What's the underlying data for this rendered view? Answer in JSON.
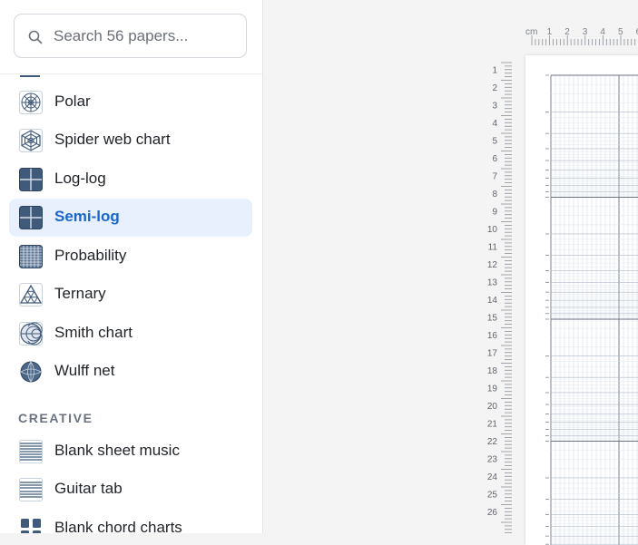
{
  "search": {
    "placeholder": "Search 56 papers..."
  },
  "items": [
    {
      "label": "Polar",
      "icon": "polar-grid-icon",
      "active": false
    },
    {
      "label": "Spider web chart",
      "icon": "spider-web-icon",
      "active": false
    },
    {
      "label": "Log-log",
      "icon": "log-log-grid-icon",
      "active": false
    },
    {
      "label": "Semi-log",
      "icon": "semi-log-grid-icon",
      "active": true
    },
    {
      "label": "Probability",
      "icon": "probability-grid-icon",
      "active": false
    },
    {
      "label": "Ternary",
      "icon": "ternary-triangle-icon",
      "active": false
    },
    {
      "label": "Smith chart",
      "icon": "smith-chart-icon",
      "active": false
    },
    {
      "label": "Wulff net",
      "icon": "wulff-net-icon",
      "active": false
    }
  ],
  "section_creative": "CREATIVE",
  "creative_items": [
    {
      "label": "Blank sheet music",
      "icon": "staff-lines-icon"
    },
    {
      "label": "Guitar tab",
      "icon": "guitar-tab-icon"
    },
    {
      "label": "Blank chord charts",
      "icon": "chord-chart-icon"
    }
  ],
  "ruler": {
    "unit": "cm",
    "top_numbers": [
      "1",
      "2",
      "3",
      "4",
      "5",
      "6"
    ],
    "left_numbers": [
      "1",
      "2",
      "3",
      "4",
      "5",
      "6",
      "7",
      "8",
      "9",
      "10",
      "11",
      "12",
      "13",
      "14",
      "15",
      "16",
      "17",
      "18",
      "19",
      "20",
      "21",
      "22",
      "23",
      "24",
      "25",
      "26"
    ]
  },
  "colors": {
    "accent": "#1a66c9",
    "active_bg": "#e8f0fe",
    "icon_fill": "#3f5a7a"
  }
}
